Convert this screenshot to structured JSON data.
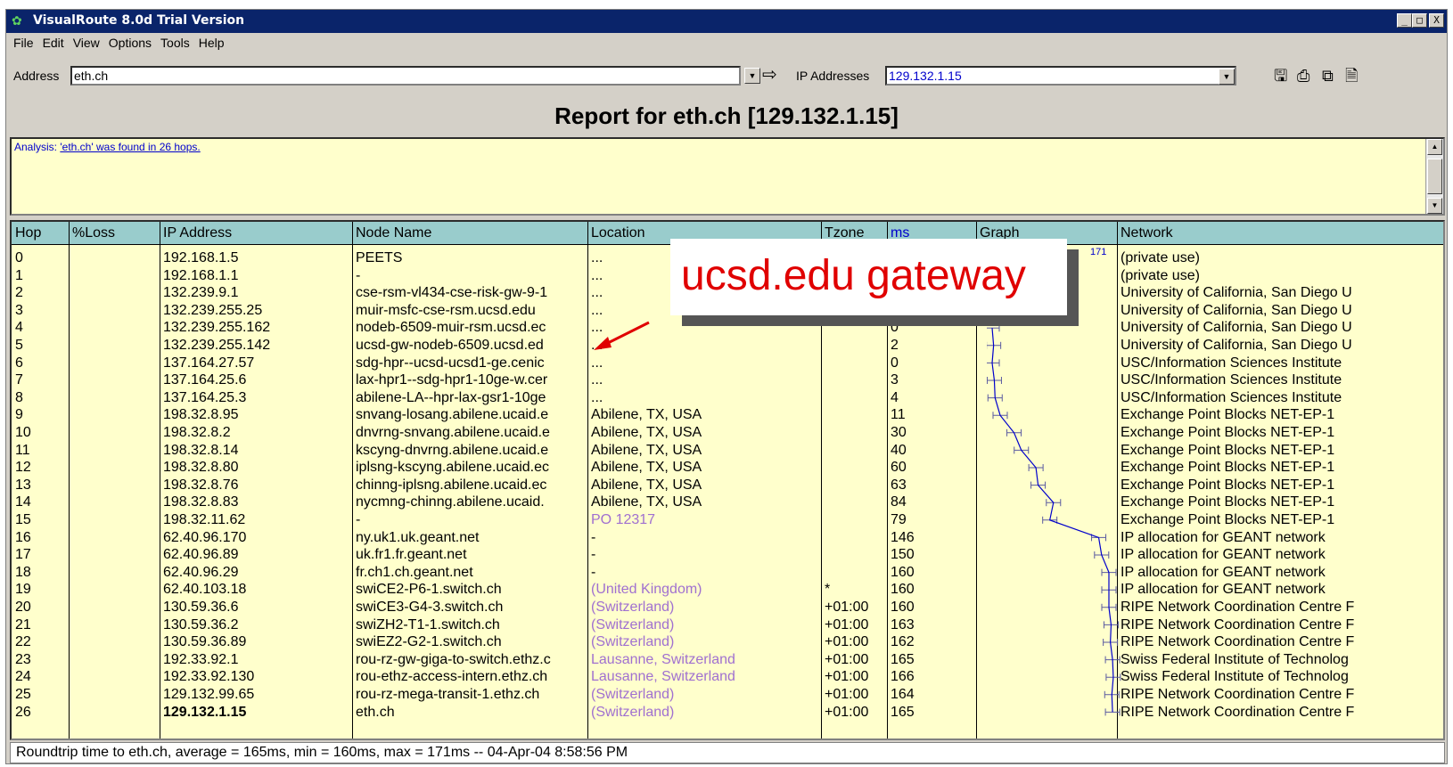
{
  "window": {
    "title": "VisualRoute 8.0d Trial Version",
    "controls": {
      "minimize": "_",
      "maximize": "□",
      "close": "X"
    }
  },
  "menu": [
    "File",
    "Edit",
    "View",
    "Options",
    "Tools",
    "Help"
  ],
  "address": {
    "label": "Address",
    "value": "eth.ch",
    "ip_label": "IP Addresses",
    "ip_value": "129.132.1.15"
  },
  "report": {
    "title": "Report for eth.ch [129.132.1.15]"
  },
  "analysis": {
    "label": "Analysis:",
    "link": "'eth.ch' was found in 26 hops."
  },
  "table": {
    "headers": [
      "Hop",
      "%Loss",
      "IP Address",
      "Node Name",
      "Location",
      "Tzone",
      "ms",
      "Graph",
      "Network"
    ],
    "graph_max": "171",
    "rows": [
      {
        "hop": "0",
        "loss": "",
        "ip": "192.168.1.5",
        "node": "PEETS",
        "loc": "...",
        "tz": "",
        "ms": "",
        "net": "(private use)"
      },
      {
        "hop": "1",
        "loss": "",
        "ip": "192.168.1.1",
        "node": "-",
        "loc": "...",
        "tz": "",
        "ms": "",
        "net": "(private use)"
      },
      {
        "hop": "2",
        "loss": "",
        "ip": "132.239.9.1",
        "node": "cse-rsm-vl434-cse-risk-gw-9-1",
        "loc": "...",
        "tz": "",
        "ms": "",
        "net": "University of California, San Diego U"
      },
      {
        "hop": "3",
        "loss": "",
        "ip": "132.239.255.25",
        "node": "muir-msfc-cse-rsm.ucsd.edu",
        "loc": "...",
        "tz": "",
        "ms": "",
        "net": "University of California, San Diego U"
      },
      {
        "hop": "4",
        "loss": "",
        "ip": "132.239.255.162",
        "node": "nodeb-6509-muir-rsm.ucsd.ec",
        "loc": "...",
        "tz": "",
        "ms": "0",
        "net": "University of California, San Diego U"
      },
      {
        "hop": "5",
        "loss": "",
        "ip": "132.239.255.142",
        "node": "ucsd-gw-nodeb-6509.ucsd.ed",
        "loc": "...",
        "tz": "",
        "ms": "2",
        "net": "University of California, San Diego U"
      },
      {
        "hop": "6",
        "loss": "",
        "ip": "137.164.27.57",
        "node": "sdg-hpr--ucsd-ucsd1-ge.cenic",
        "loc": "...",
        "tz": "",
        "ms": "0",
        "net": "USC/Information Sciences Institute"
      },
      {
        "hop": "7",
        "loss": "",
        "ip": "137.164.25.6",
        "node": "lax-hpr1--sdg-hpr1-10ge-w.cer",
        "loc": "...",
        "tz": "",
        "ms": "3",
        "net": "USC/Information Sciences Institute"
      },
      {
        "hop": "8",
        "loss": "",
        "ip": "137.164.25.3",
        "node": "abilene-LA--hpr-lax-gsr1-10ge",
        "loc": "...",
        "tz": "",
        "ms": "4",
        "net": "USC/Information Sciences Institute"
      },
      {
        "hop": "9",
        "loss": "",
        "ip": "198.32.8.95",
        "node": "snvang-losang.abilene.ucaid.e",
        "loc": "Abilene, TX, USA",
        "tz": "",
        "ms": "11",
        "net": "Exchange Point Blocks NET-EP-1"
      },
      {
        "hop": "10",
        "loss": "",
        "ip": "198.32.8.2",
        "node": "dnvrng-snvang.abilene.ucaid.e",
        "loc": "Abilene, TX, USA",
        "tz": "",
        "ms": "30",
        "net": "Exchange Point Blocks NET-EP-1"
      },
      {
        "hop": "11",
        "loss": "",
        "ip": "198.32.8.14",
        "node": "kscyng-dnvrng.abilene.ucaid.e",
        "loc": "Abilene, TX, USA",
        "tz": "",
        "ms": "40",
        "net": "Exchange Point Blocks NET-EP-1"
      },
      {
        "hop": "12",
        "loss": "",
        "ip": "198.32.8.80",
        "node": "iplsng-kscyng.abilene.ucaid.ec",
        "loc": "Abilene, TX, USA",
        "tz": "",
        "ms": "60",
        "net": "Exchange Point Blocks NET-EP-1"
      },
      {
        "hop": "13",
        "loss": "",
        "ip": "198.32.8.76",
        "node": "chinng-iplsng.abilene.ucaid.ec",
        "loc": "Abilene, TX, USA",
        "tz": "",
        "ms": "63",
        "net": "Exchange Point Blocks NET-EP-1"
      },
      {
        "hop": "14",
        "loss": "",
        "ip": "198.32.8.83",
        "node": "nycmng-chinng.abilene.ucaid.",
        "loc": "Abilene, TX, USA",
        "tz": "",
        "ms": "84",
        "net": "Exchange Point Blocks NET-EP-1"
      },
      {
        "hop": "15",
        "loss": "",
        "ip": "198.32.11.62",
        "node": "-",
        "loc": "PO 12317",
        "locPurple": true,
        "tz": "",
        "ms": "79",
        "net": "Exchange Point Blocks NET-EP-1"
      },
      {
        "hop": "16",
        "loss": "",
        "ip": "62.40.96.170",
        "node": "ny.uk1.uk.geant.net",
        "loc": "-",
        "tz": "",
        "ms": "146",
        "net": "IP allocation for GEANT network"
      },
      {
        "hop": "17",
        "loss": "",
        "ip": "62.40.96.89",
        "node": "uk.fr1.fr.geant.net",
        "loc": "-",
        "tz": "",
        "ms": "150",
        "net": "IP allocation for GEANT network"
      },
      {
        "hop": "18",
        "loss": "",
        "ip": "62.40.96.29",
        "node": "fr.ch1.ch.geant.net",
        "loc": "-",
        "tz": "",
        "ms": "160",
        "net": "IP allocation for GEANT network"
      },
      {
        "hop": "19",
        "loss": "",
        "ip": "62.40.103.18",
        "node": "swiCE2-P6-1.switch.ch",
        "loc": "(United Kingdom)",
        "locPurple": true,
        "tz": "*",
        "ms": "160",
        "net": "IP allocation for GEANT network"
      },
      {
        "hop": "20",
        "loss": "",
        "ip": "130.59.36.6",
        "node": "swiCE3-G4-3.switch.ch",
        "loc": "(Switzerland)",
        "locPurple": true,
        "tz": "+01:00",
        "ms": "160",
        "net": "RIPE Network Coordination Centre F"
      },
      {
        "hop": "21",
        "loss": "",
        "ip": "130.59.36.2",
        "node": "swiZH2-T1-1.switch.ch",
        "loc": "(Switzerland)",
        "locPurple": true,
        "tz": "+01:00",
        "ms": "163",
        "net": "RIPE Network Coordination Centre F"
      },
      {
        "hop": "22",
        "loss": "",
        "ip": "130.59.36.89",
        "node": "swiEZ2-G2-1.switch.ch",
        "loc": "(Switzerland)",
        "locPurple": true,
        "tz": "+01:00",
        "ms": "162",
        "net": "RIPE Network Coordination Centre F"
      },
      {
        "hop": "23",
        "loss": "",
        "ip": "192.33.92.1",
        "node": "rou-rz-gw-giga-to-switch.ethz.c",
        "loc": "Lausanne, Switzerland",
        "locPurple": true,
        "tz": "+01:00",
        "ms": "165",
        "net": "Swiss Federal Institute of Technolog"
      },
      {
        "hop": "24",
        "loss": "",
        "ip": "192.33.92.130",
        "node": "rou-ethz-access-intern.ethz.ch",
        "loc": "Lausanne, Switzerland",
        "locPurple": true,
        "tz": "+01:00",
        "ms": "166",
        "net": "Swiss Federal Institute of Technolog"
      },
      {
        "hop": "25",
        "loss": "",
        "ip": "129.132.99.65",
        "node": "rou-rz-mega-transit-1.ethz.ch",
        "loc": "(Switzerland)",
        "locPurple": true,
        "tz": "+01:00",
        "ms": "164",
        "net": "RIPE Network Coordination Centre F"
      },
      {
        "hop": "26",
        "loss": "",
        "ip": "129.132.1.15",
        "ipBold": true,
        "node": "eth.ch",
        "loc": "(Switzerland)",
        "locPurple": true,
        "tz": "+01:00",
        "ms": "165",
        "net": "RIPE Network Coordination Centre F"
      }
    ]
  },
  "status": "Roundtrip time to eth.ch, average = 165ms, min = 160ms, max = 171ms -- 04-Apr-04 8:58:56 PM",
  "callout": "ucsd.edu gateway",
  "colors": {
    "grid_bg": "#ffffcc",
    "header_bg": "#99cccc",
    "callout_text": "#e00000",
    "graph_line": "#0000cc"
  }
}
